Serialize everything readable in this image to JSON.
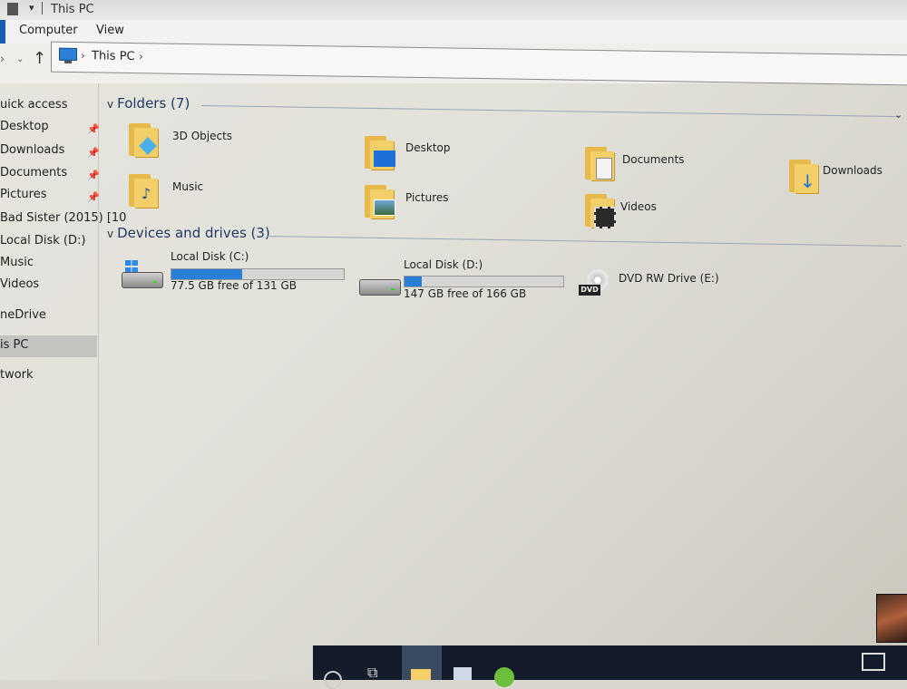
{
  "window": {
    "title": "This PC"
  },
  "ribbon": {
    "tabs": [
      "Computer",
      "View"
    ]
  },
  "address": {
    "crumbs": [
      "This PC"
    ]
  },
  "sidebar": {
    "items": [
      {
        "label": "uick access",
        "pinned": false
      },
      {
        "label": "Desktop",
        "pinned": true
      },
      {
        "label": "Downloads",
        "pinned": true
      },
      {
        "label": "Documents",
        "pinned": true
      },
      {
        "label": "Pictures",
        "pinned": true
      },
      {
        "label": "Bad Sister (2015) [10",
        "pinned": false
      },
      {
        "label": "Local Disk (D:)",
        "pinned": false
      },
      {
        "label": "Music",
        "pinned": false
      },
      {
        "label": "Videos",
        "pinned": false
      },
      {
        "label": "neDrive",
        "pinned": false
      },
      {
        "label": "is PC",
        "pinned": false,
        "selected": true
      },
      {
        "label": "twork",
        "pinned": false
      }
    ]
  },
  "folders": {
    "heading": "Folders (7)",
    "items": [
      {
        "label": "3D Objects",
        "icon": "3d-cube-icon"
      },
      {
        "label": "Desktop",
        "icon": "monitor-icon"
      },
      {
        "label": "Documents",
        "icon": "document-icon"
      },
      {
        "label": "Downloads",
        "icon": "download-arrow-icon"
      },
      {
        "label": "Music",
        "icon": "music-note-icon"
      },
      {
        "label": "Pictures",
        "icon": "picture-icon"
      },
      {
        "label": "Videos",
        "icon": "film-icon"
      }
    ]
  },
  "drives": {
    "heading": "Devices and drives (3)",
    "items": [
      {
        "name": "Local Disk (C:)",
        "free": "77.5 GB free of 131 GB",
        "used_fraction": 0.41,
        "icon": "windows-drive-icon"
      },
      {
        "name": "Local Disk (D:)",
        "free": "147 GB free of 166 GB",
        "used_fraction": 0.11,
        "icon": "hard-drive-icon"
      },
      {
        "name": "DVD RW Drive (E:)",
        "free": "",
        "icon": "dvd-drive-icon",
        "badge": "DVD"
      }
    ]
  },
  "colors": {
    "accent": "#2a80d8",
    "taskbar": "#141c2b",
    "folder": "#f3cf6a"
  }
}
